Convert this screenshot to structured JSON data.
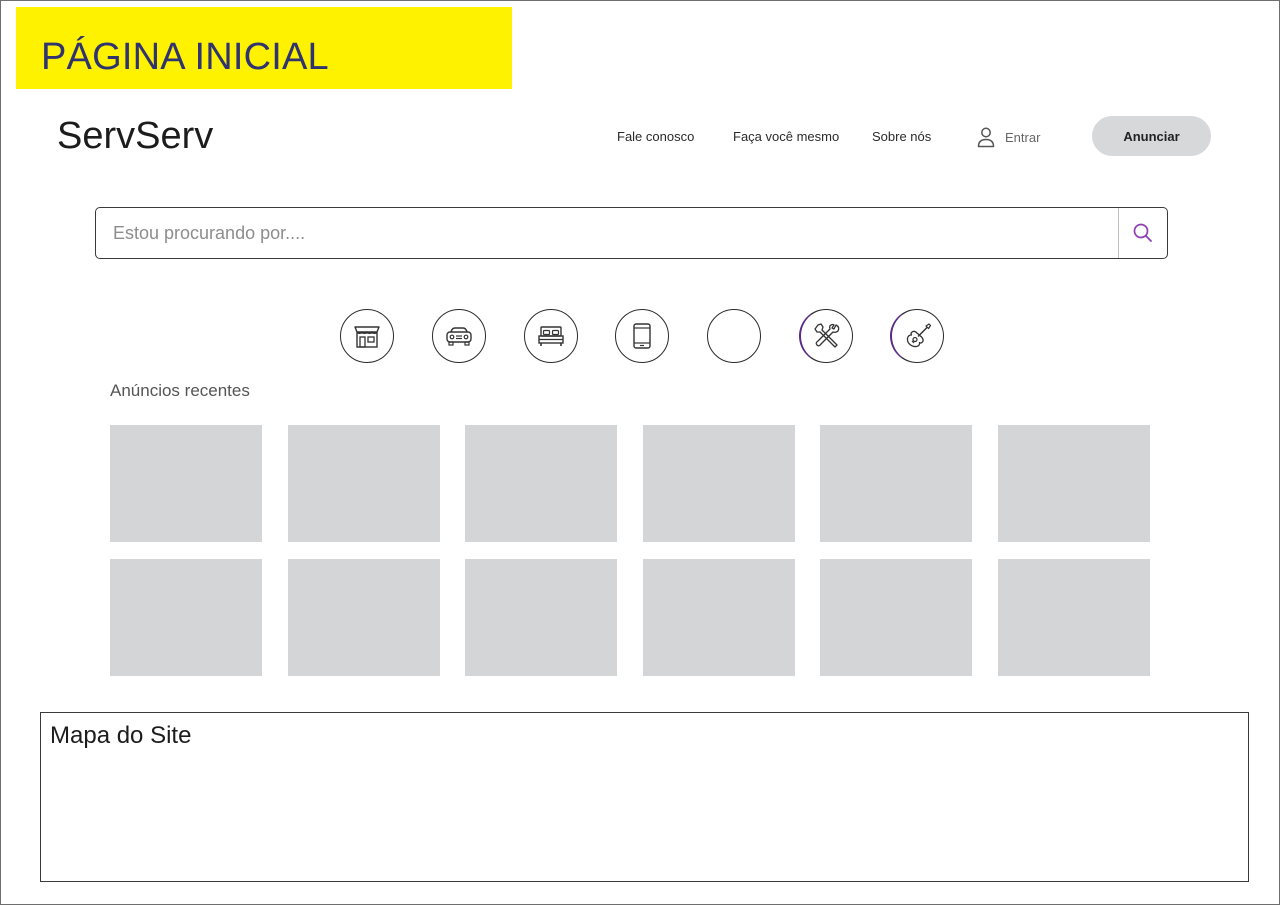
{
  "page_label": "PÁGINA INICIAL",
  "header": {
    "logo": "ServServ",
    "nav": {
      "contact": "Fale conosco",
      "diy": "Faça você mesmo",
      "about": "Sobre nós"
    },
    "login": {
      "label": "Entrar",
      "icon": "user-icon"
    },
    "cta": "Anunciar"
  },
  "search": {
    "placeholder": "Estou procurando por....",
    "value": "",
    "icon": "search-icon",
    "icon_color": "#8e3fb3"
  },
  "categories": [
    {
      "icon": "store-icon"
    },
    {
      "icon": "car-icon"
    },
    {
      "icon": "bed-icon"
    },
    {
      "icon": "tablet-icon"
    },
    {
      "icon": "blank-icon"
    },
    {
      "icon": "tools-icon"
    },
    {
      "icon": "guitar-icon"
    }
  ],
  "recent": {
    "title": "Anúncios recentes",
    "placeholder_color": "#d4d5d7",
    "rows": 2,
    "columns": 6
  },
  "footer": {
    "sitemap_title": "Mapa do Site"
  },
  "colors": {
    "label_bg": "#fff200",
    "label_text": "#2f3470",
    "button_bg": "#d7d8da"
  }
}
